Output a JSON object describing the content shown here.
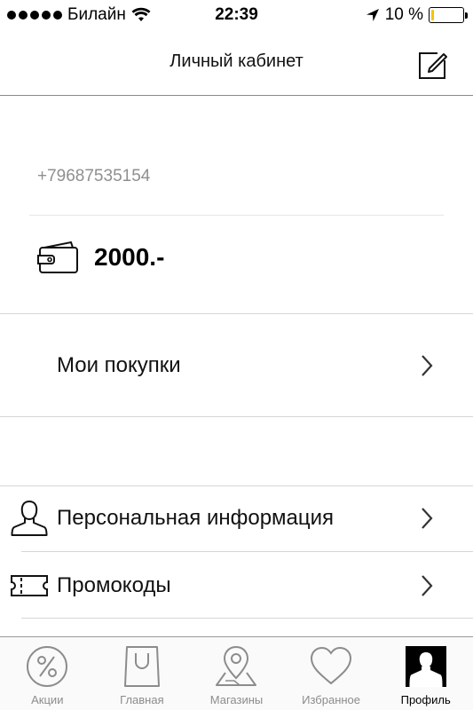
{
  "status_bar": {
    "carrier": "Билайн",
    "time": "22:39",
    "battery_text": "10 %",
    "battery_level": 0.1,
    "battery_color": "#f5c400"
  },
  "header": {
    "title": "Личный кабинет",
    "edit_icon": "edit-icon"
  },
  "profile": {
    "phone": "+79687535154",
    "balance": "2000.-",
    "wallet_icon": "wallet-icon"
  },
  "menu": {
    "purchases": "Мои покупки",
    "personal_info": "Персональная информация",
    "promocodes": "Промокоды"
  },
  "tabs": [
    {
      "label": "Акции",
      "icon": "percent-icon",
      "active": false
    },
    {
      "label": "Главная",
      "icon": "shopping-bag-icon",
      "active": false
    },
    {
      "label": "Магазины",
      "icon": "map-pin-icon",
      "active": false
    },
    {
      "label": "Избранное",
      "icon": "heart-icon",
      "active": false
    },
    {
      "label": "Профиль",
      "icon": "profile-icon",
      "active": true
    }
  ]
}
